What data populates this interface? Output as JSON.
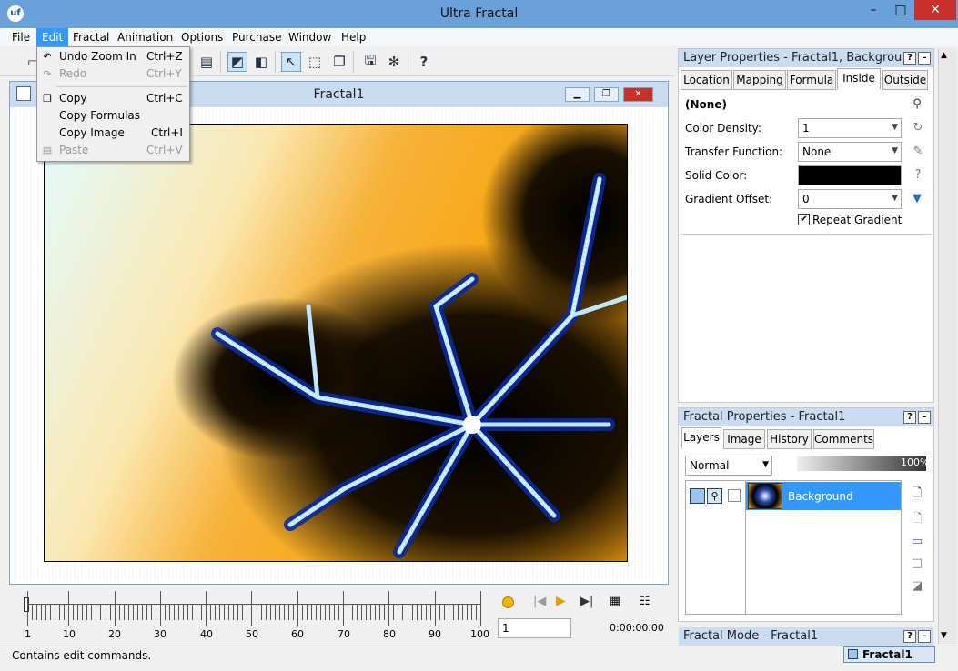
{
  "app": {
    "title": "Ultra Fractal",
    "icon_text": "uf"
  },
  "window_controls": {
    "minimize": "–",
    "maximize": "□",
    "close": "✕"
  },
  "menubar": [
    "File",
    "Edit",
    "Fractal",
    "Animation",
    "Options",
    "Purchase",
    "Window",
    "Help"
  ],
  "edit_menu": [
    {
      "label": "Undo Zoom In",
      "shortcut": "Ctrl+Z",
      "enabled": true
    },
    {
      "label": "Redo",
      "shortcut": "Ctrl+Y",
      "enabled": false
    },
    {
      "label": "Copy",
      "shortcut": "Ctrl+C",
      "enabled": true
    },
    {
      "label": "Copy Formulas",
      "shortcut": "",
      "enabled": true
    },
    {
      "label": "Copy Image",
      "shortcut": "Ctrl+I",
      "enabled": true
    },
    {
      "label": "Paste",
      "shortcut": "Ctrl+V",
      "enabled": false
    }
  ],
  "toolbar": {
    "help_glyph": "?"
  },
  "document": {
    "title": "Fractal1"
  },
  "timeline": {
    "ticks": [
      "1",
      "10",
      "20",
      "30",
      "40",
      "50",
      "60",
      "70",
      "80",
      "90",
      "100"
    ],
    "frame": "1",
    "time": "0:00:00.00"
  },
  "status": {
    "text": "Contains edit commands.",
    "window_tab": "Fractal1"
  },
  "layer_props": {
    "title": "Layer Properties - Fractal1, Backgrou...",
    "tabs": [
      "Location",
      "Mapping",
      "Formula",
      "Inside",
      "Outside"
    ],
    "active_tab": "Inside",
    "formula": "(None)",
    "color_density_label": "Color Density:",
    "color_density": "1",
    "transfer_label": "Transfer Function:",
    "transfer": "None",
    "solid_label": "Solid Color:",
    "solid_color": "#000000",
    "gradient_label": "Gradient Offset:",
    "gradient_offset": "0",
    "repeat_label": "Repeat Gradient",
    "repeat_checked": true
  },
  "fractal_props": {
    "title": "Fractal Properties - Fractal1",
    "tabs": [
      "Layers",
      "Image",
      "History",
      "Comments"
    ],
    "active_tab": "Layers",
    "blend_mode": "Normal",
    "opacity": "100%",
    "layer_name": "Background"
  },
  "fractal_mode": {
    "title": "Fractal Mode - Fractal1"
  },
  "panel_buttons": {
    "help": "?",
    "minimize": "–"
  },
  "colors": {
    "title_bar": "#6ca0d8",
    "selection": "#3399ff",
    "panel_header": "#c9dcf1"
  }
}
